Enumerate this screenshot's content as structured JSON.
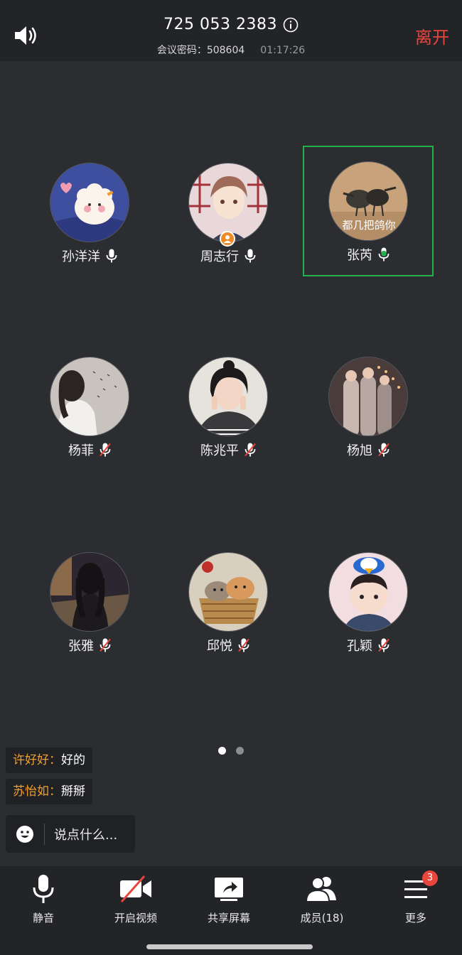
{
  "header": {
    "meeting_id": "725 053 2383",
    "password_label": "会议密码：",
    "password_value": "508604",
    "timer": "01:17:26",
    "leave_label": "离开"
  },
  "participants": [
    {
      "name": "孙洋洋",
      "mic": "on"
    },
    {
      "name": "周志行",
      "mic": "on",
      "host": true
    },
    {
      "name": "张芮",
      "mic": "speaking",
      "active": true,
      "avatar_caption": "都几把鸽你"
    },
    {
      "name": "杨菲",
      "mic": "muted"
    },
    {
      "name": "陈兆平",
      "mic": "muted"
    },
    {
      "name": "杨旭",
      "mic": "muted"
    },
    {
      "name": "张雅",
      "mic": "muted"
    },
    {
      "name": "邱悦",
      "mic": "muted"
    },
    {
      "name": "孔颖",
      "mic": "muted"
    }
  ],
  "pager": {
    "current": 1,
    "total": 2
  },
  "chat": {
    "messages": [
      {
        "sender": "许好好：",
        "text": "好的"
      },
      {
        "sender": "苏怡如：",
        "text": "掰掰"
      }
    ],
    "input_placeholder": "说点什么..."
  },
  "toolbar": {
    "mute_label": "静音",
    "video_label": "开启视频",
    "share_label": "共享屏幕",
    "members_label": "成员(18)",
    "more_label": "更多",
    "more_badge": "3"
  },
  "colors": {
    "background": "#2b2d31",
    "bar": "#222427",
    "leave": "#e8453c",
    "active_speaker": "#22b14c",
    "chat_sender": "#f0a030",
    "badge": "#e8453c"
  }
}
